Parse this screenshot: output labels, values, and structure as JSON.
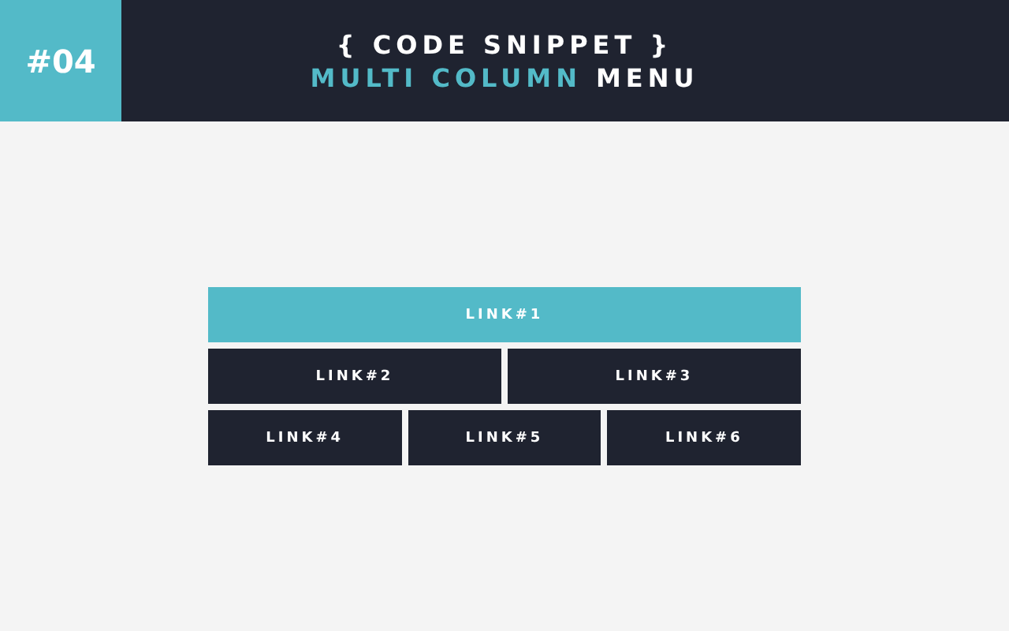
{
  "header": {
    "badge": "#04",
    "title": "{ CODE SNIPPET }",
    "subtitle_highlight": "MULTI COLUMN",
    "subtitle_rest": "MENU"
  },
  "menu": {
    "rows": [
      [
        {
          "label": "LINK#1",
          "selected": true
        }
      ],
      [
        {
          "label": "LINK#2",
          "selected": false
        },
        {
          "label": "LINK#3",
          "selected": false
        }
      ],
      [
        {
          "label": "LINK#4",
          "selected": false
        },
        {
          "label": "LINK#5",
          "selected": false
        },
        {
          "label": "LINK#6",
          "selected": false
        }
      ]
    ]
  }
}
